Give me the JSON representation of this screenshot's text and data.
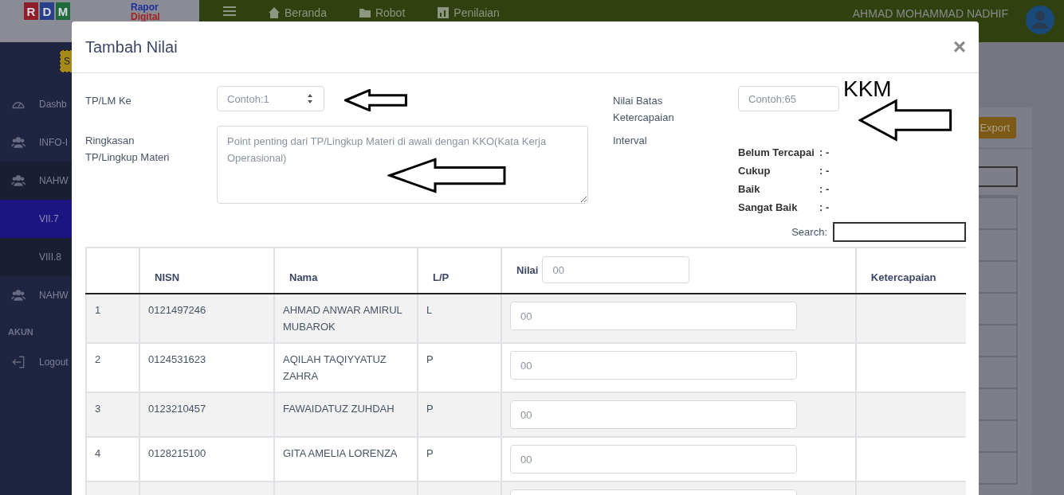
{
  "header": {
    "logo_letters": [
      "R",
      "D",
      "M"
    ],
    "logo_title": "Rapor",
    "logo_subtitle": "Digital",
    "nav": [
      {
        "label": "Beranda"
      },
      {
        "label": "Robot"
      },
      {
        "label": "Penilaian"
      }
    ],
    "user_name": "AHMAD MOHAMMAD NADHIF"
  },
  "sidebar": {
    "badge": "S",
    "items": [
      {
        "kind": "item",
        "label": "Dashb",
        "selected": false
      },
      {
        "kind": "item",
        "label": "INFO-I",
        "selected": false
      },
      {
        "kind": "group",
        "label": "NAHW",
        "selected": false
      },
      {
        "kind": "sub",
        "label": "VII.7",
        "selected": true
      },
      {
        "kind": "sub",
        "label": "VIII.8",
        "selected": false
      },
      {
        "kind": "item",
        "label": "NAHW",
        "selected": false
      },
      {
        "kind": "section",
        "label": "AKUN"
      },
      {
        "kind": "item",
        "label": "Logout",
        "selected": false
      }
    ]
  },
  "background": {
    "export_button": "Export"
  },
  "modal": {
    "title": "Tambah Nilai",
    "close": "×",
    "tp_label": "TP/LM Ke",
    "tp_placeholder": "Contoh:1",
    "summary_label": "Ringkasan TP/Lingkup Materi",
    "summary_placeholder": "Point penting dari TP/Lingkup Materi di awali dengan KKO(Kata Kerja Operasional)",
    "threshold_label": "Nilai Batas Ketercapaian",
    "threshold_placeholder": "Contoh:65",
    "interval_label": "Interval",
    "interval": [
      {
        "label": "Belum Tercapai",
        "value": ": -"
      },
      {
        "label": "Cukup",
        "value": ": -"
      },
      {
        "label": "Baik",
        "value": ": -"
      },
      {
        "label": "Sangat Baik",
        "value": ": -"
      }
    ],
    "annotation": "KKM",
    "search_label": "Search:",
    "table": {
      "columns": [
        "NISN",
        "Nama",
        "L/P",
        "Nilai",
        "Ketercapaian"
      ],
      "nilai_placeholder": "00",
      "rows": [
        {
          "no": "1",
          "nisn": "0121497246",
          "nama": "AHMAD ANWAR AMIRUL MUBAROK",
          "lp": "L",
          "placeholder": "00"
        },
        {
          "no": "2",
          "nisn": "0124531623",
          "nama": "AQILAH TAQIYYATUZ ZAHRA",
          "lp": "P",
          "placeholder": "00"
        },
        {
          "no": "3",
          "nisn": "0123210457",
          "nama": "FAWAIDATUZ ZUHDAH",
          "lp": "P",
          "placeholder": "00"
        },
        {
          "no": "4",
          "nisn": "0128215100",
          "nama": "GITA AMELIA LORENZA",
          "lp": "P",
          "placeholder": "00"
        }
      ]
    }
  }
}
